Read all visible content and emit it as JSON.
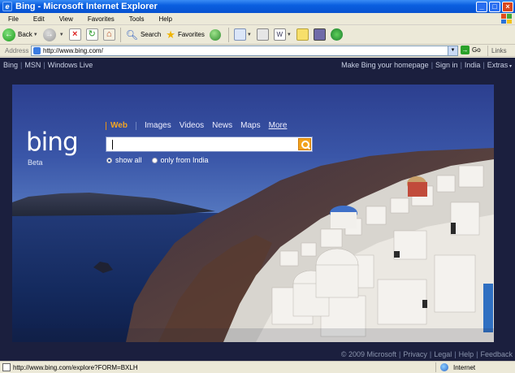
{
  "window": {
    "title": "Bing - Microsoft Internet Explorer"
  },
  "menu": [
    "File",
    "Edit",
    "View",
    "Favorites",
    "Tools",
    "Help"
  ],
  "toolbar": {
    "back_label": "Back",
    "search_label": "Search",
    "favorites_label": "Favorites"
  },
  "address": {
    "label": "Address",
    "url": "http://www.bing.com/",
    "go_label": "Go",
    "links_label": "Links"
  },
  "page": {
    "topnav_left": [
      "Bing",
      "MSN",
      "Windows Live"
    ],
    "topnav_right": [
      "Make Bing your homepage",
      "Sign in",
      "India",
      "Extras"
    ],
    "logo_text": "bing",
    "beta_label": "Beta",
    "tabs": [
      "Web",
      "Images",
      "Videos",
      "News",
      "Maps",
      "More"
    ],
    "search_value": "",
    "radio_options": [
      "show all",
      "only from India"
    ],
    "selected_radio": "show all",
    "footer": [
      "© 2009 Microsoft",
      "Privacy",
      "Legal",
      "Help",
      "Feedback"
    ]
  },
  "status": {
    "url": "http://www.bing.com/explore?FORM=BXLH",
    "zone": "Internet"
  },
  "colors": {
    "accent": "#f5a623",
    "titlebar": "#0a5fe0"
  }
}
